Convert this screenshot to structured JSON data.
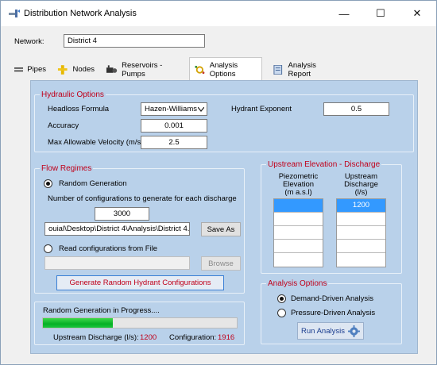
{
  "window": {
    "title": "Distribution Network Analysis",
    "minimize": "—",
    "maximize": "☐",
    "close": "✕"
  },
  "network": {
    "label": "Network:",
    "value": "District 4"
  },
  "tabs": [
    {
      "label": "Pipes",
      "icon": "pipe-icon",
      "active": false
    },
    {
      "label": "Nodes",
      "icon": "node-icon",
      "active": false
    },
    {
      "label": "Reservoirs - Pumps",
      "icon": "pump-icon",
      "active": false
    },
    {
      "label": "Analysis Options",
      "icon": "options-icon",
      "active": true
    },
    {
      "label": "Analysis Report",
      "icon": "report-icon",
      "active": false
    }
  ],
  "hydraulic": {
    "title": "Hydraulic Options",
    "headloss_label": "Headloss Formula",
    "headloss_value": "Hazen-Williams",
    "accuracy_label": "Accuracy",
    "accuracy_value": "0.001",
    "velocity_label": "Max Allowable Velocity (m/s)",
    "velocity_value": "2.5",
    "hydrant_label": "Hydrant Exponent",
    "hydrant_value": "0.5"
  },
  "flow": {
    "title": "Flow Regimes",
    "random_label": "Random Generation",
    "configs_label": "Number of configurations to generate for each discharge",
    "configs_value": "3000",
    "path_value": "ouial\\Desktop\\District 4\\Analysis\\District 4.hyc",
    "save_as": "Save As",
    "read_label": "Read configurations from File",
    "browse": "Browse",
    "generate": "Generate Random Hydrant Configurations"
  },
  "upstream": {
    "title": "Upstream Elevation - Discharge",
    "col1": [
      "Piezometric",
      "Elevation",
      "(m a.s.l)"
    ],
    "col2": [
      "Upstream",
      "Discharge",
      "(l/s)"
    ],
    "col1_values": [
      "",
      "",
      "",
      "",
      ""
    ],
    "col2_values": [
      "1200",
      "",
      "",
      "",
      ""
    ]
  },
  "analysis": {
    "title": "Analysis Options",
    "demand_label": "Demand-Driven Analysis",
    "pressure_label": "Pressure-Driven Analysis",
    "run_label": "Run Analysis"
  },
  "progress": {
    "title": "Random Generation in Progress....",
    "fraction": 0.36,
    "discharge_label": "Upstream Discharge (l/s):",
    "discharge_value": "1200",
    "config_label": "Configuration:",
    "config_value": "1916"
  },
  "colors": {
    "panel": "#b9d1ea",
    "group_title": "#c0001a",
    "progress_green": "#06b025",
    "selection": "#3399ff"
  }
}
